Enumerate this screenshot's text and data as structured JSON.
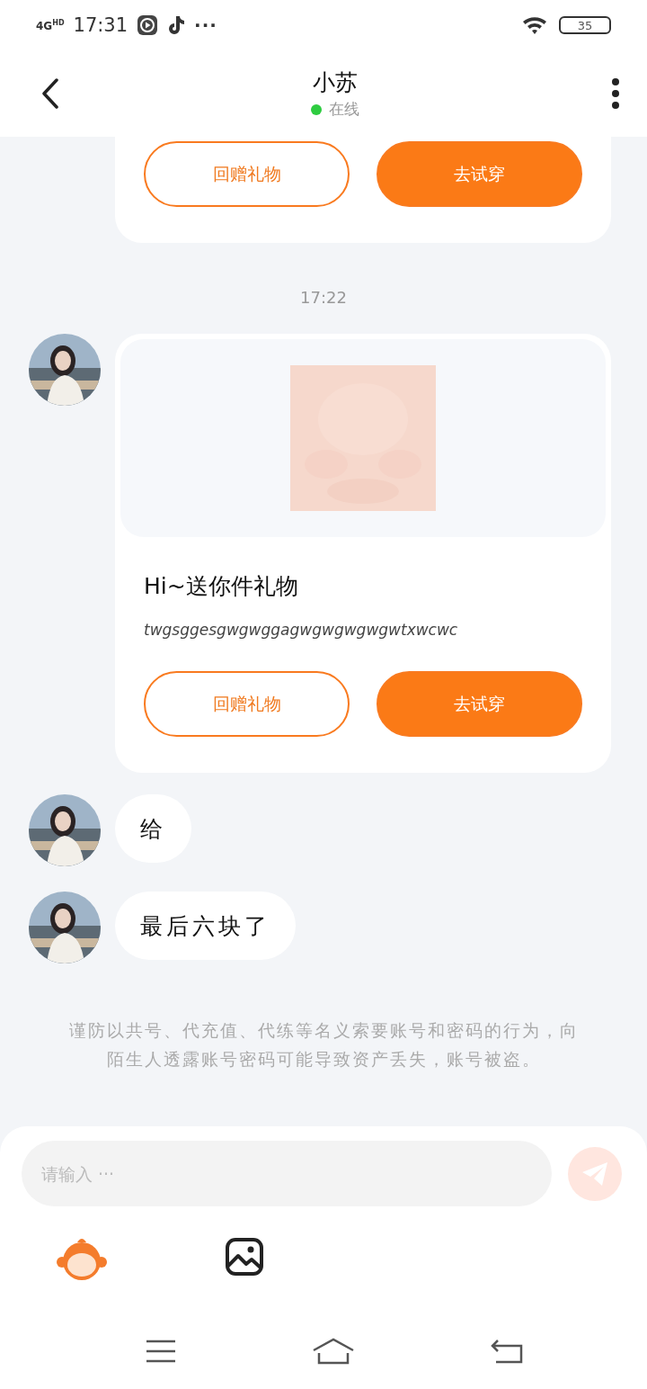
{
  "status_bar": {
    "network": "4G",
    "network_suffix": "HD",
    "time": "17:31",
    "more": "···",
    "battery": "35"
  },
  "header": {
    "title": "小苏",
    "status": "在线",
    "online": true
  },
  "messages": [
    {
      "kind": "gift_cut",
      "buttons": [
        {
          "label": "回赠礼物",
          "kind": "outline"
        },
        {
          "label": "去试穿",
          "kind": "filled"
        }
      ]
    },
    {
      "kind": "time",
      "text": "17:22"
    },
    {
      "kind": "gift",
      "title": "Hi~送你件礼物",
      "description": "twgsggesgwgwggagwgwgwgwgwtxwcwc",
      "buttons": [
        {
          "label": "回赠礼物",
          "kind": "outline"
        },
        {
          "label": "去试穿",
          "kind": "filled"
        }
      ]
    },
    {
      "kind": "text",
      "text": "给"
    },
    {
      "kind": "text",
      "text": "最后六块了"
    }
  ],
  "notice": "谨防以共号、代充值、代练等名义索要账号和密码的行为，向陌生人透露账号密码可能导致资产丢失，账号被盗。",
  "composer": {
    "placeholder": "请输入 ···"
  }
}
